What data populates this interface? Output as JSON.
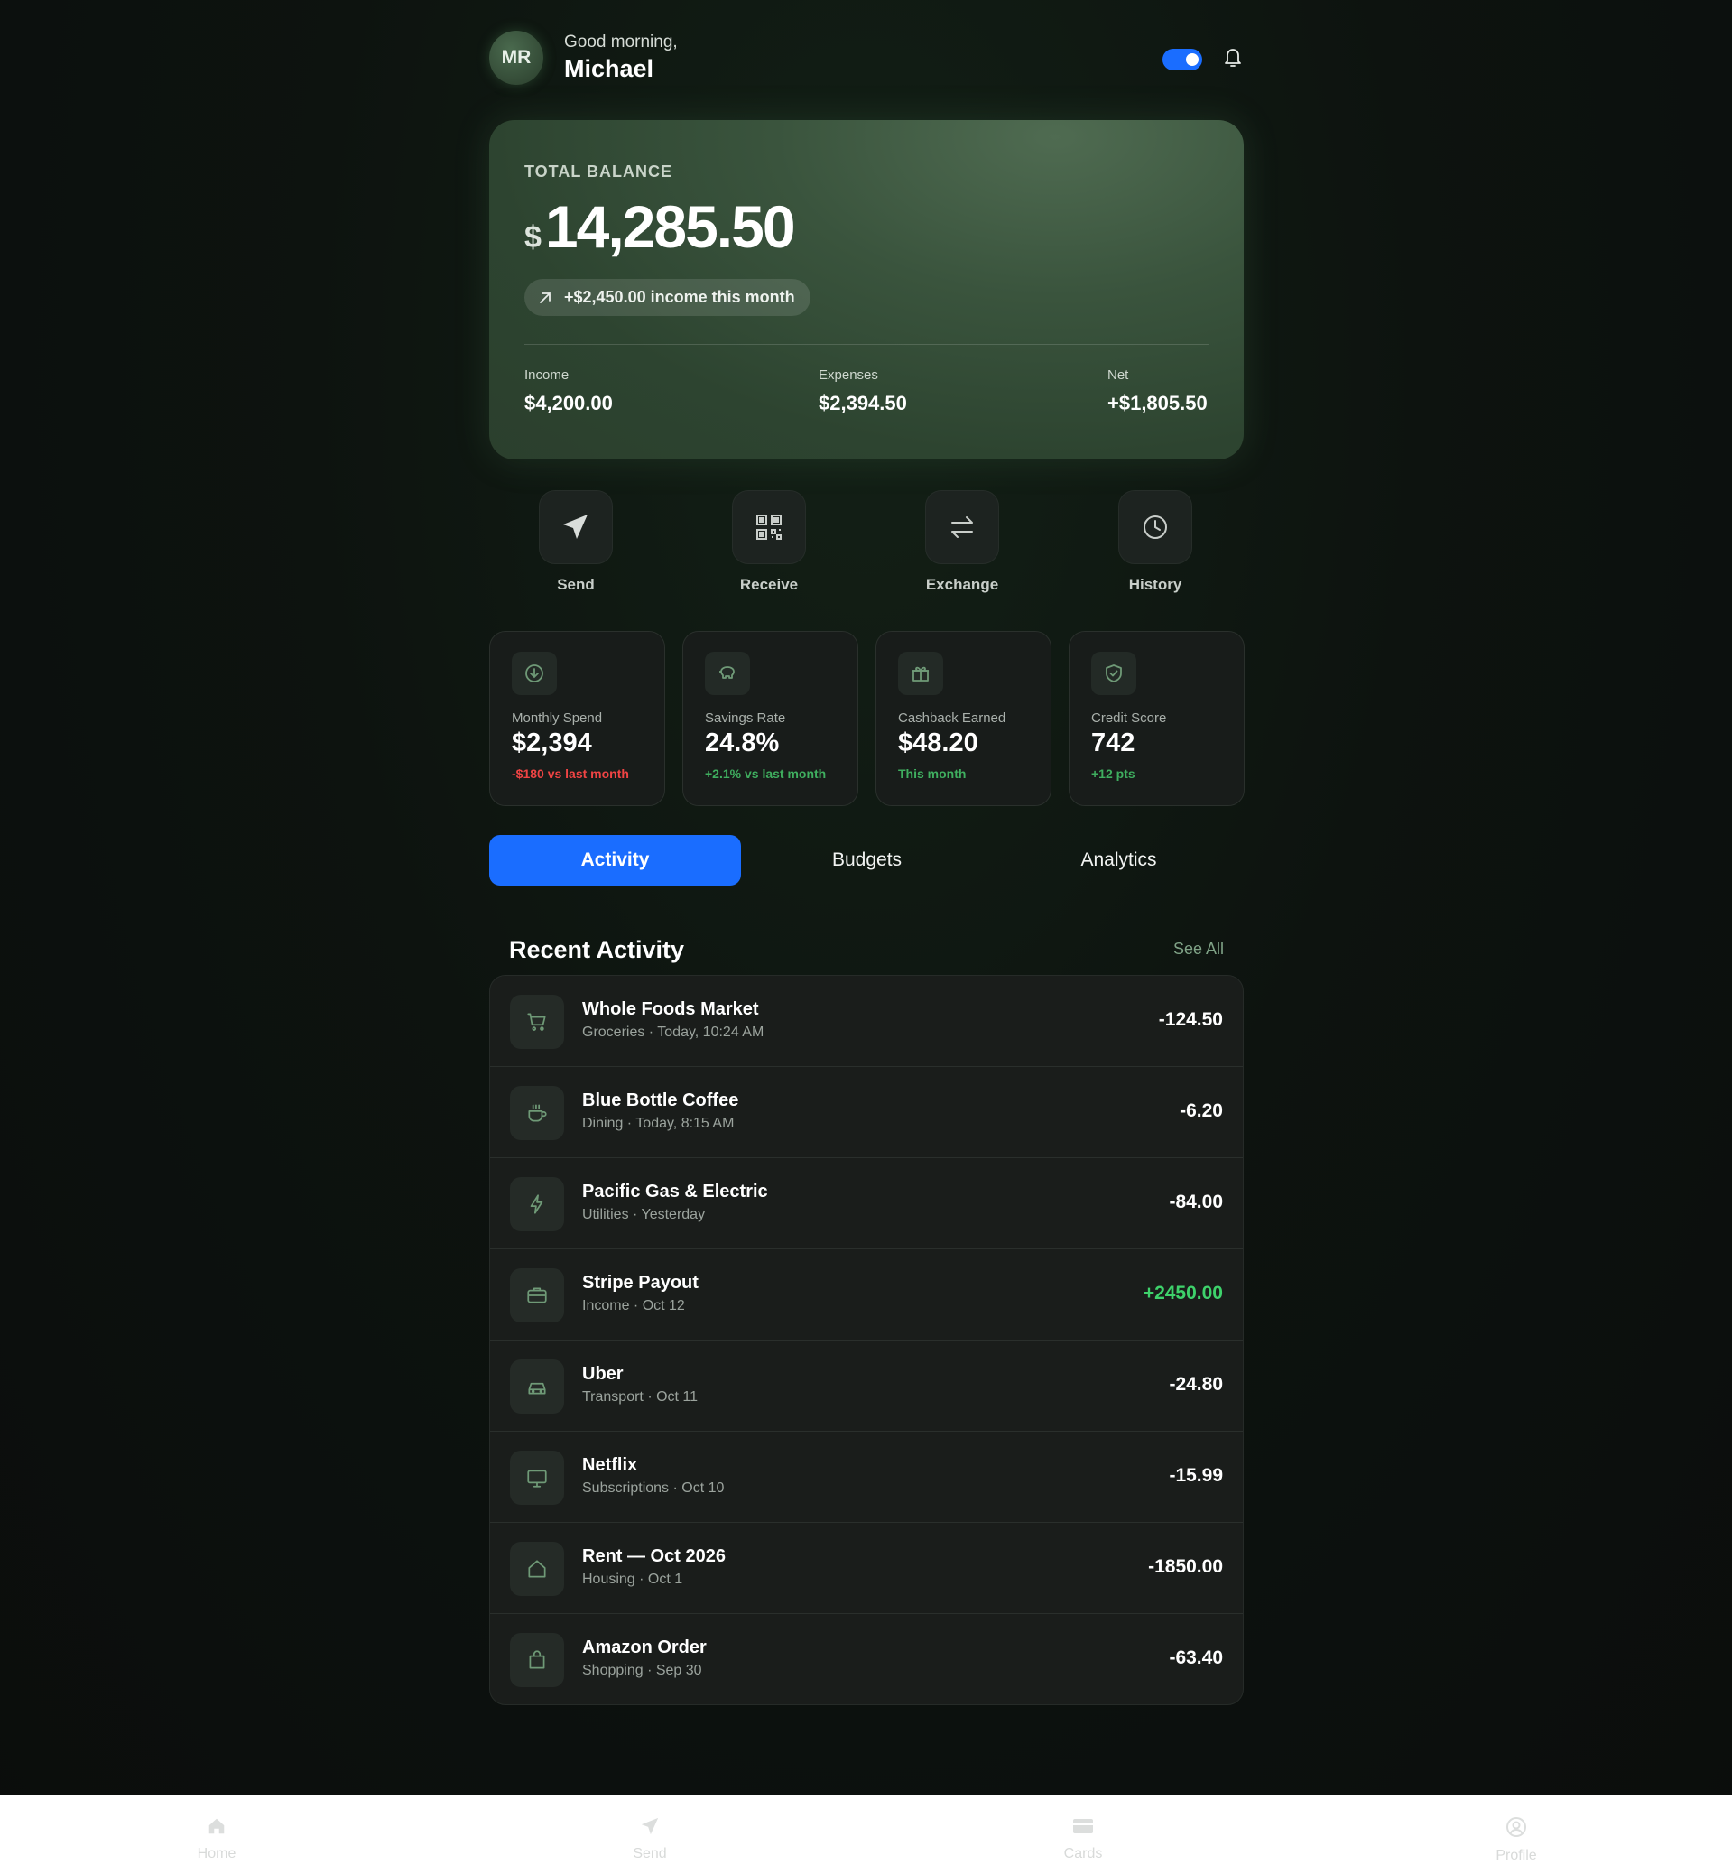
{
  "header": {
    "avatar_initials": "MR",
    "greeting": "Good morning,",
    "user_name": "Michael",
    "toggle_on": true
  },
  "balance": {
    "label": "TOTAL BALANCE",
    "currency": "$",
    "amount": "14,285.50",
    "income_pill": "+$2,450.00 income this month",
    "stats": [
      {
        "label": "Income",
        "value": "$4,200.00"
      },
      {
        "label": "Expenses",
        "value": "$2,394.50"
      },
      {
        "label": "Net",
        "value": "+$1,805.50"
      }
    ]
  },
  "actions": [
    {
      "label": "Send",
      "icon": "send-icon"
    },
    {
      "label": "Receive",
      "icon": "qr-code-icon"
    },
    {
      "label": "Exchange",
      "icon": "exchange-icon"
    },
    {
      "label": "History",
      "icon": "clock-icon"
    }
  ],
  "metrics": [
    {
      "label": "Monthly Spend",
      "value": "$2,394",
      "sub": "-$180 vs last month",
      "sub_color": "#ef4444",
      "icon": "download-circle-icon"
    },
    {
      "label": "Savings Rate",
      "value": "24.8%",
      "sub": "+2.1% vs last month",
      "sub_color": "#3fae5f",
      "icon": "piggy-bank-icon"
    },
    {
      "label": "Cashback Earned",
      "value": "$48.20",
      "sub": "This month",
      "sub_color": "#3fae5f",
      "icon": "gift-icon"
    },
    {
      "label": "Credit Score",
      "value": "742",
      "sub": "+12 pts",
      "sub_color": "#3fae5f",
      "icon": "shield-check-icon"
    }
  ],
  "tabs": [
    {
      "label": "Activity",
      "active": true
    },
    {
      "label": "Budgets",
      "active": false
    },
    {
      "label": "Analytics",
      "active": false
    }
  ],
  "recent": {
    "title": "Recent Activity",
    "see_all": "See All",
    "transactions": [
      {
        "name": "Whole Foods Market",
        "meta": "Groceries · Today, 10:24 AM",
        "amount": "-124.50",
        "icon": "cart-icon"
      },
      {
        "name": "Blue Bottle Coffee",
        "meta": "Dining · Today, 8:15 AM",
        "amount": "-6.20",
        "icon": "coffee-icon"
      },
      {
        "name": "Pacific Gas & Electric",
        "meta": "Utilities · Yesterday",
        "amount": "-84.00",
        "icon": "bolt-icon"
      },
      {
        "name": "Stripe Payout",
        "meta": "Income · Oct 12",
        "amount": "+2450.00",
        "icon": "briefcase-icon"
      },
      {
        "name": "Uber",
        "meta": "Transport · Oct 11",
        "amount": "-24.80",
        "icon": "car-icon"
      },
      {
        "name": "Netflix",
        "meta": "Subscriptions · Oct 10",
        "amount": "-15.99",
        "icon": "monitor-icon"
      },
      {
        "name": "Rent — Oct 2026",
        "meta": "Housing · Oct 1",
        "amount": "-1850.00",
        "icon": "home-icon"
      },
      {
        "name": "Amazon Order",
        "meta": "Shopping · Sep 30",
        "amount": "-63.40",
        "icon": "shopping-bag-icon"
      }
    ]
  },
  "bottom_nav": [
    {
      "label": "Home",
      "icon": "home-icon"
    },
    {
      "label": "Send",
      "icon": "send-icon"
    },
    {
      "label": "Cards",
      "icon": "card-icon"
    },
    {
      "label": "Profile",
      "icon": "user-circle-icon"
    }
  ],
  "colors": {
    "accent": "#1a6dff",
    "positive": "#3ed26b",
    "negative": "#ef4444",
    "card_green": "#3a543d"
  }
}
